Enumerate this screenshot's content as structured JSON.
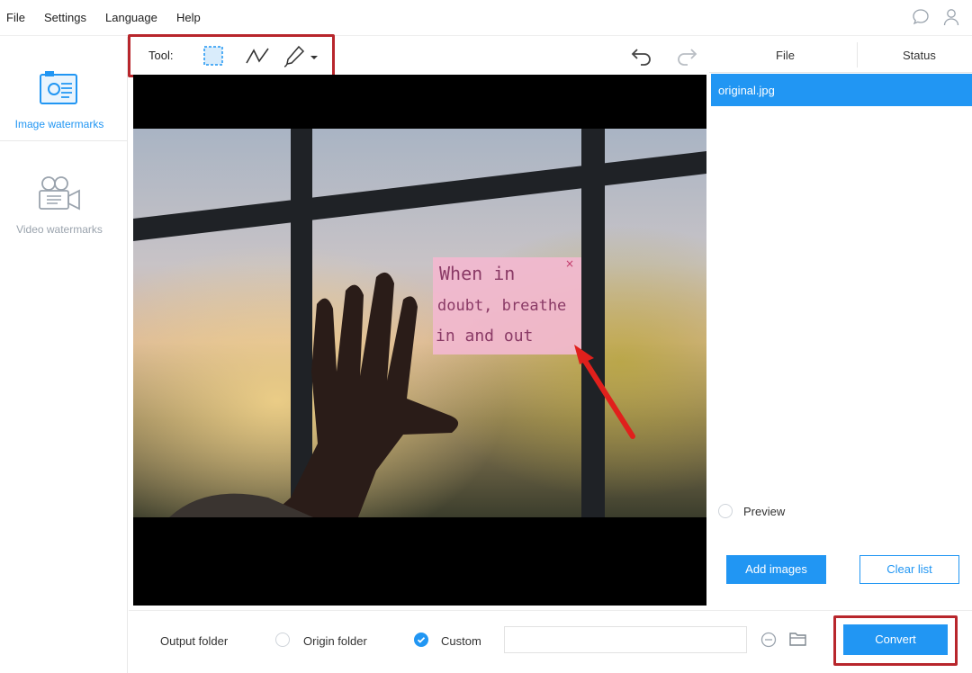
{
  "menu": {
    "file": "File",
    "settings": "Settings",
    "language": "Language",
    "help": "Help"
  },
  "top_icons": [
    "chat-icon",
    "user-icon"
  ],
  "sidebar": {
    "items": [
      {
        "label": "Image watermarks",
        "icon": "image-watermark-icon",
        "active": true
      },
      {
        "label": "Video watermarks",
        "icon": "video-watermark-icon",
        "active": false
      }
    ]
  },
  "toolbar": {
    "tool_label": "Tool:",
    "tools": [
      "selection-rect-icon",
      "polyline-icon",
      "brush-icon",
      "dropdown-arrow-icon"
    ],
    "undo_icon": "undo-icon",
    "redo_icon": "redo-icon"
  },
  "file_list": {
    "columns": [
      "File",
      "Status"
    ],
    "rows": [
      {
        "file": "original.jpg",
        "status": ""
      }
    ]
  },
  "preview": {
    "label": "Preview",
    "checked": false
  },
  "buttons": {
    "add_images": "Add images",
    "clear_list": "Clear list",
    "convert": "Convert"
  },
  "output": {
    "label": "Output folder",
    "origin_folder": "Origin folder",
    "custom": "Custom",
    "selected": "Custom",
    "path": ""
  },
  "canvas": {
    "note_text": [
      "When in",
      "doubt, breathe",
      "in and out"
    ]
  },
  "colors": {
    "accent": "#2196f3",
    "highlight_border": "#b8262c",
    "arrow": "#e0201c",
    "note": "#f2b8cf"
  }
}
